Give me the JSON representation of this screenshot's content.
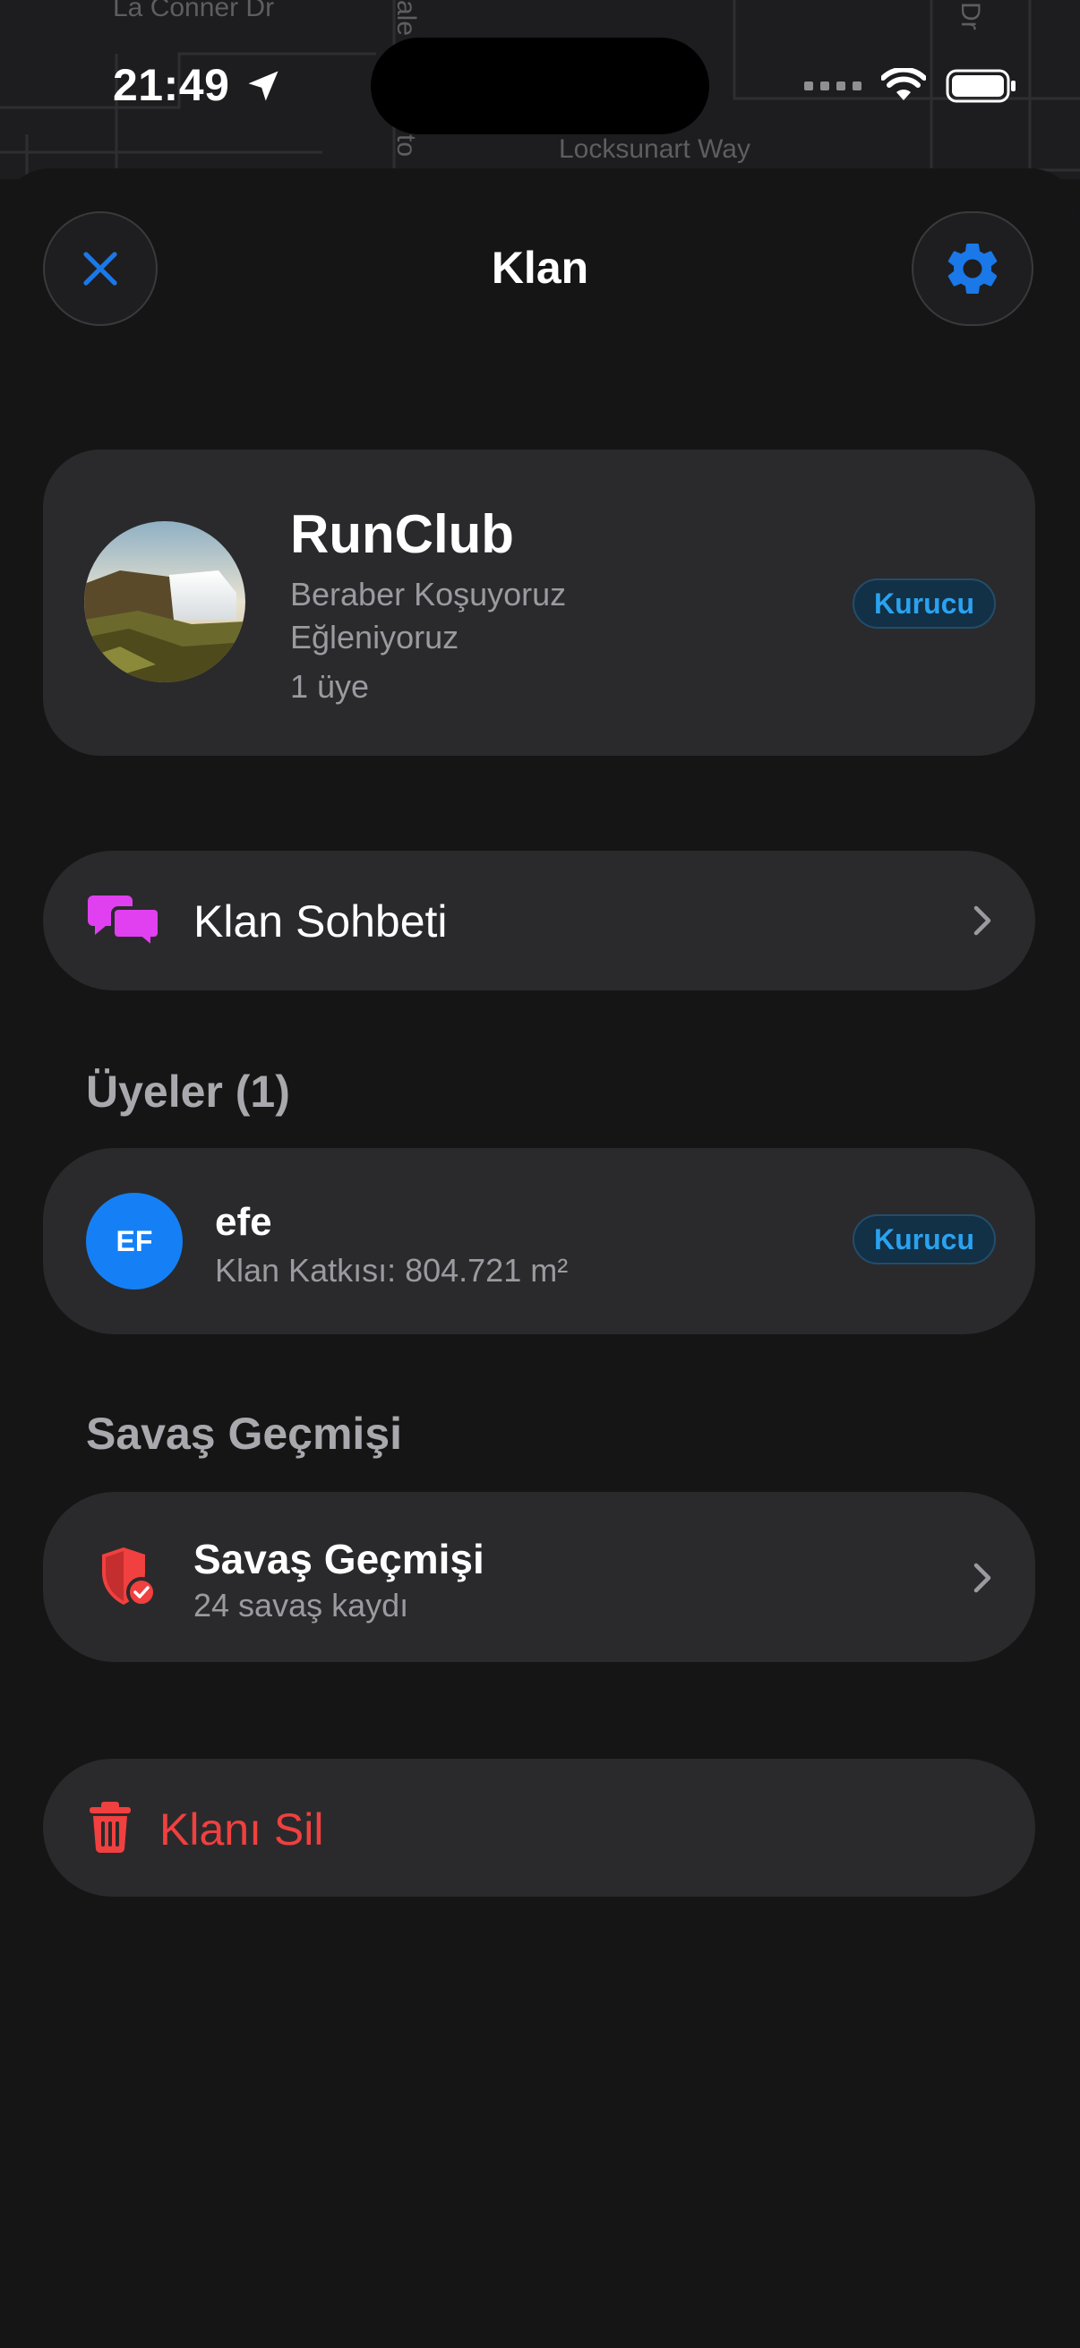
{
  "status_bar": {
    "time": "21:49",
    "location_icon": "location-arrow-icon",
    "signal_icon": "cellular-dots-icon",
    "wifi_icon": "wifi-icon",
    "battery_icon": "battery-icon"
  },
  "map": {
    "street_labels": [
      "La Conner Dr",
      "Locksunart Way",
      "Dr",
      "ale",
      "to"
    ]
  },
  "header": {
    "title": "Klan",
    "close_icon": "close-icon",
    "settings_icon": "gear-icon"
  },
  "clan": {
    "name": "RunClub",
    "description": "Beraber Koşuyoruz Eğleniyoruz",
    "member_count": "1 üye",
    "role_badge": "Kurucu",
    "avatar": "waterfall-photo"
  },
  "chat": {
    "label": "Klan Sohbeti",
    "icon": "chat-bubbles-icon"
  },
  "members": {
    "title": "Üyeler (1)",
    "items": [
      {
        "initials": "EF",
        "name": "efe",
        "contribution": "Klan Katkısı: 804.721 m²",
        "role": "Kurucu"
      }
    ]
  },
  "war_history": {
    "section_title": "Savaş Geçmişi",
    "label": "Savaş Geçmişi",
    "subtitle": "24 savaş kaydı",
    "icon": "shield-check-icon"
  },
  "delete": {
    "label": "Klanı Sil",
    "icon": "trash-icon"
  },
  "colors": {
    "background": "#151516",
    "card": "#2a2a2c",
    "accent_blue": "#1a78e8",
    "badge_text": "#2aa2f0",
    "chat_icon": "#e040f0",
    "danger": "#f0403f",
    "secondary_text": "#9a9aa0"
  }
}
